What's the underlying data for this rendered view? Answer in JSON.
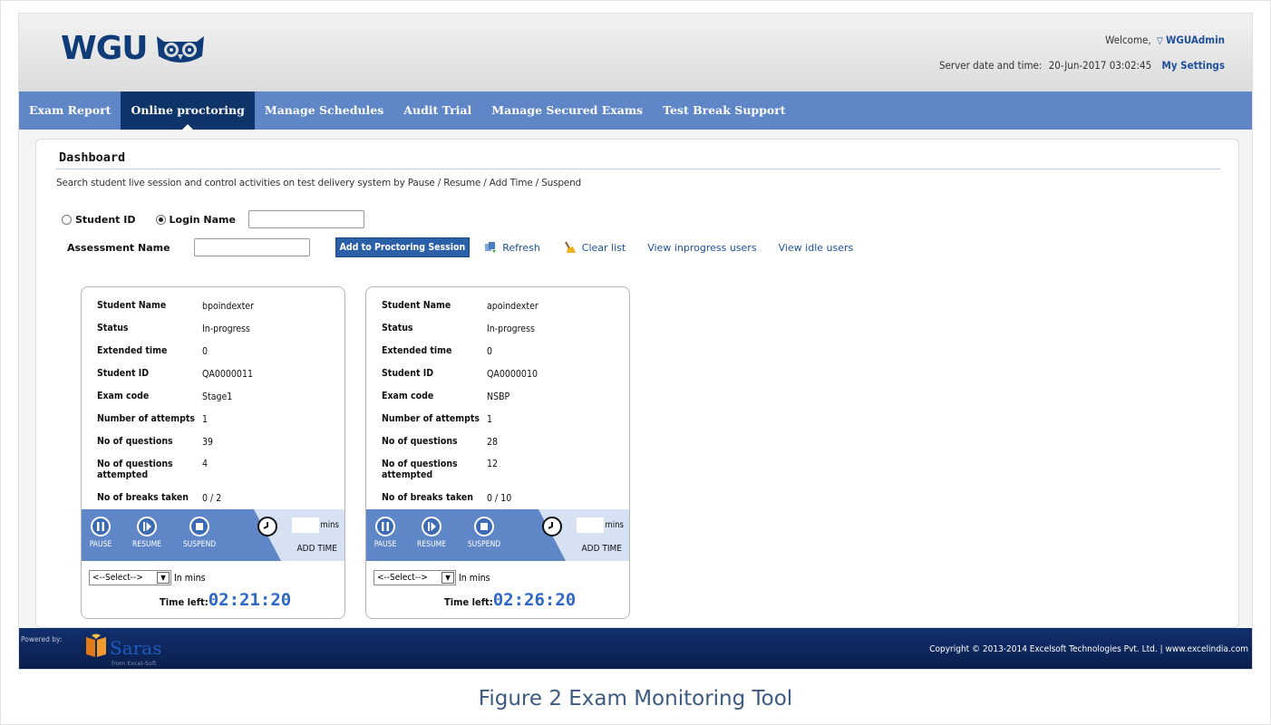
{
  "header": {
    "logo_text": "WGU",
    "welcome_prefix": "Welcome,",
    "username": "WGUAdmin",
    "server_time_label": "Server date and time:",
    "server_time_value": "20-Jun-2017 03:02:45",
    "my_settings": "My Settings"
  },
  "nav": {
    "items": [
      "Exam Report",
      "Online proctoring",
      "Manage Schedules",
      "Audit Trial",
      "Manage Secured Exams",
      "Test Break Support"
    ],
    "active_index": 1
  },
  "dashboard": {
    "title": "Dashboard",
    "description": "Search student live session and control activities on test delivery system by Pause / Resume / Add Time / Suspend",
    "radio_student_id": "Student ID",
    "radio_login_name": "Login Name",
    "login_name_value": "",
    "assessment_label": "Assessment Name",
    "assessment_value": "",
    "add_button": "Add to Proctoring Session",
    "refresh": "Refresh",
    "clear_list": "Clear list",
    "view_inprogress": "View inprogress users",
    "view_idle": "View idle users"
  },
  "card_labels": {
    "student_name": "Student Name",
    "status": "Status",
    "extended_time": "Extended time",
    "student_id": "Student ID",
    "exam_code": "Exam code",
    "attempts": "Number of attempts",
    "questions": "No of questions",
    "questions_attempted": "No of questions attempted",
    "breaks": "No of breaks taken",
    "pause": "PAUSE",
    "resume": "RESUME",
    "suspend": "SUSPEND",
    "mins": "mins",
    "add_time": "ADD TIME",
    "select_placeholder": "<--Select-->",
    "in_mins": "In mins",
    "time_left": "Time left:"
  },
  "students": [
    {
      "name": "bpoindexter",
      "status": "In-progress",
      "extended_time": "0",
      "student_id": "QA0000011",
      "exam_code": "Stage1",
      "attempts": "1",
      "questions": "39",
      "questions_attempted": "4",
      "breaks": "0 / 2",
      "time_left": "02:21:20"
    },
    {
      "name": "apoindexter",
      "status": "In-progress",
      "extended_time": "0",
      "student_id": "QA0000010",
      "exam_code": "NSBP",
      "attempts": "1",
      "questions": "28",
      "questions_attempted": "12",
      "breaks": "0 / 10",
      "time_left": "02:26:20"
    }
  ],
  "footer": {
    "powered_by": "Powered by:",
    "brand": "Saras",
    "brand_sub": "from Excel-Soft",
    "copyright": "Copyright © 2013-2014 Excelsoft Technologies Pvt. Ltd. |   www.excelindia.com"
  },
  "caption": "Figure 2 Exam Monitoring Tool",
  "colors": {
    "nav": "#5f87c7",
    "nav_active": "#0f3469",
    "link": "#1f4f9c",
    "timer": "#2d67c4",
    "footer": "#122f6e"
  }
}
